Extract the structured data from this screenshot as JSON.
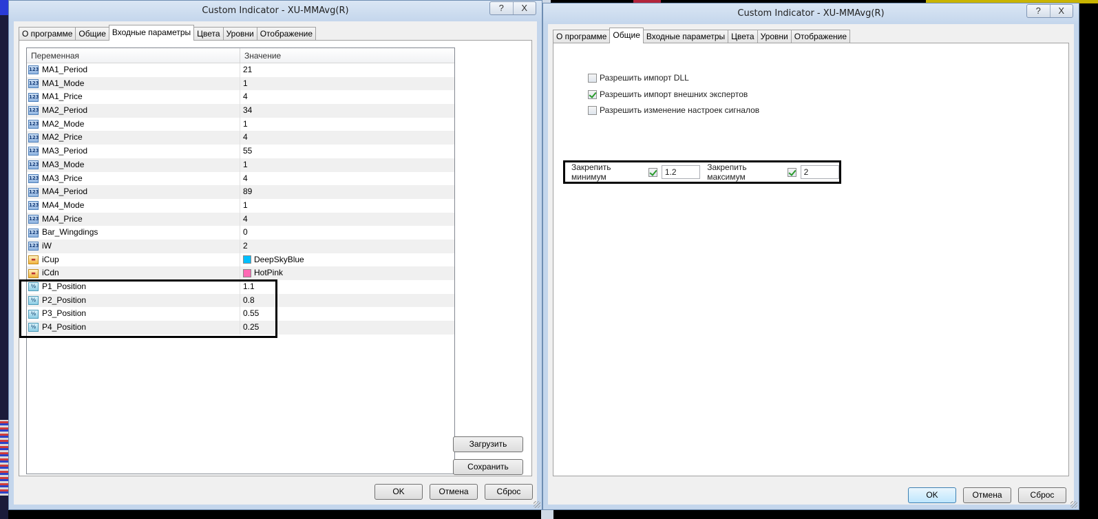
{
  "left_window": {
    "title": "Custom Indicator - XU-MMAvg(R)",
    "title_buttons": [
      "?",
      "X"
    ],
    "tabs": [
      "О программе",
      "Общие",
      "Входные параметры",
      "Цвета",
      "Уровни",
      "Отображение"
    ],
    "active_tab": "Входные параметры",
    "grid": {
      "headers": [
        "Переменная",
        "Значение"
      ],
      "rows": [
        {
          "name": "MA1_Period",
          "value": "21",
          "icon": "int-icon"
        },
        {
          "name": "MA1_Mode",
          "value": "1",
          "icon": "int-icon"
        },
        {
          "name": "MA1_Price",
          "value": "4",
          "icon": "int-icon"
        },
        {
          "name": "MA2_Period",
          "value": "34",
          "icon": "int-icon"
        },
        {
          "name": "MA2_Mode",
          "value": "1",
          "icon": "int-icon"
        },
        {
          "name": "MA2_Price",
          "value": "4",
          "icon": "int-icon"
        },
        {
          "name": "MA3_Period",
          "value": "55",
          "icon": "int-icon"
        },
        {
          "name": "MA3_Mode",
          "value": "1",
          "icon": "int-icon"
        },
        {
          "name": "MA3_Price",
          "value": "4",
          "icon": "int-icon"
        },
        {
          "name": "MA4_Period",
          "value": "89",
          "icon": "int-icon"
        },
        {
          "name": "MA4_Mode",
          "value": "1",
          "icon": "int-icon"
        },
        {
          "name": "MA4_Price",
          "value": "4",
          "icon": "int-icon"
        },
        {
          "name": "Bar_Wingdings",
          "value": "0",
          "icon": "int-icon"
        },
        {
          "name": "iW",
          "value": "2",
          "icon": "int-icon"
        },
        {
          "name": "iCup",
          "value": "DeepSkyBlue",
          "icon": "color-icon",
          "swatch": "#00bfff"
        },
        {
          "name": "iCdn",
          "value": "HotPink",
          "icon": "color-icon",
          "swatch": "#ff69b4"
        },
        {
          "name": "P1_Position",
          "value": "1.1",
          "icon": "double-icon"
        },
        {
          "name": "P2_Position",
          "value": "0.8",
          "icon": "double-icon"
        },
        {
          "name": "P3_Position",
          "value": "0.55",
          "icon": "double-icon"
        },
        {
          "name": "P4_Position",
          "value": "0.25",
          "icon": "double-icon"
        }
      ]
    },
    "load_button": "Загрузить",
    "save_button": "Сохранить",
    "ok_button": "OK",
    "cancel_button": "Отмена",
    "reset_button": "Сброс"
  },
  "right_window": {
    "title": "Custom Indicator - XU-MMAvg(R)",
    "title_buttons": [
      "?",
      "X"
    ],
    "tabs": [
      "О программе",
      "Общие",
      "Входные параметры",
      "Цвета",
      "Уровни",
      "Отображение"
    ],
    "active_tab": "Общие",
    "options": [
      {
        "label": "Разрешить импорт DLL",
        "checked": false
      },
      {
        "label": "Разрешить импорт внешних экспертов",
        "checked": true
      },
      {
        "label": "Разрешить изменение настроек сигналов",
        "checked": false
      }
    ],
    "fix_min_label": "Закрепить минимум",
    "fix_min_checked": true,
    "fix_min_value": "1.2",
    "fix_max_label": "Закрепить максимум",
    "fix_max_checked": true,
    "fix_max_value": "2",
    "ok_button": "OK",
    "cancel_button": "Отмена",
    "reset_button": "Сброс"
  }
}
